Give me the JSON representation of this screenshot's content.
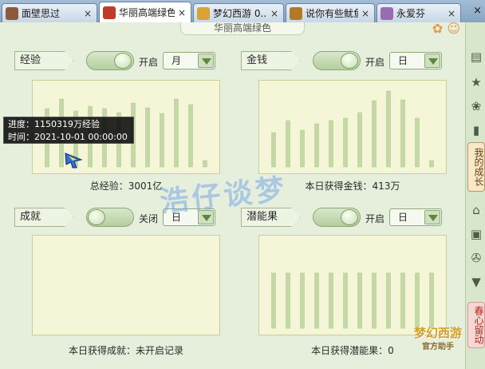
{
  "tabs": [
    {
      "label": "面壁思过",
      "color": "#8a5a3a",
      "active": false
    },
    {
      "label": "华丽高端绿色",
      "color": "#c23a2a",
      "active": true
    },
    {
      "label": "梦幻西游 0...",
      "color": "#d7a23a",
      "active": false
    },
    {
      "label": "说你有些鱿鱼",
      "color": "#b07a2a",
      "active": false
    },
    {
      "label": "永爱芬",
      "color": "#9a6bb0",
      "active": false
    }
  ],
  "tab_close_glyph": "×",
  "header": {
    "title": "华丽高端绿色"
  },
  "sections": {
    "exp": {
      "label": "经验",
      "toggle_text": "开启",
      "toggle_on": true,
      "period": "月",
      "footer": "总经验：3001亿",
      "chart_data": {
        "type": "bar",
        "title": "",
        "values": [
          0.73,
          0.85,
          0.7,
          0.76,
          0.73,
          0.68,
          0.8,
          0.74,
          0.67,
          0.85,
          0.78,
          0.08
        ],
        "ylim": [
          0,
          1
        ]
      }
    },
    "money": {
      "label": "金钱",
      "toggle_text": "开启",
      "toggle_on": true,
      "period": "日",
      "footer": "本日获得金钱：413万",
      "chart_data": {
        "type": "bar",
        "title": "",
        "values": [
          0.43,
          0.58,
          0.46,
          0.54,
          0.58,
          0.61,
          0.68,
          0.83,
          0.95,
          0.84,
          0.61,
          0.08
        ],
        "ylim": [
          0,
          1
        ]
      }
    },
    "achieve": {
      "label": "成就",
      "toggle_text": "关闭",
      "toggle_on": false,
      "period": "日",
      "footer": "本日获得成就：未开启记录",
      "chart_data": {
        "type": "bar",
        "title": "",
        "values": [],
        "ylim": [
          0,
          1
        ]
      }
    },
    "potential": {
      "label": "潜能果",
      "toggle_text": "开启",
      "toggle_on": true,
      "period": "日",
      "footer": "本日获得潜能果：0",
      "chart_data": {
        "type": "bar",
        "title": "",
        "values": [
          0.64,
          0.64,
          0.64,
          0.64,
          0.64,
          0.64,
          0.64,
          0.64,
          0.64,
          0.64,
          0.64,
          0.64
        ],
        "ylim": [
          0,
          1
        ]
      }
    }
  },
  "tooltip": {
    "line1": "进度：1150319万经验",
    "line2": "时间：2021-10-01 00:00:00"
  },
  "watermark": "浩仔谈梦",
  "sidebar": {
    "my_growth": "我的成长",
    "spring": "春心留动"
  },
  "logo": {
    "main": "梦幻西游",
    "sub": "官方助手"
  },
  "colors": {
    "bar": "#c5d8a6",
    "bar_stroke": "#aac48a",
    "chart_bg": "#f5f6d8"
  }
}
